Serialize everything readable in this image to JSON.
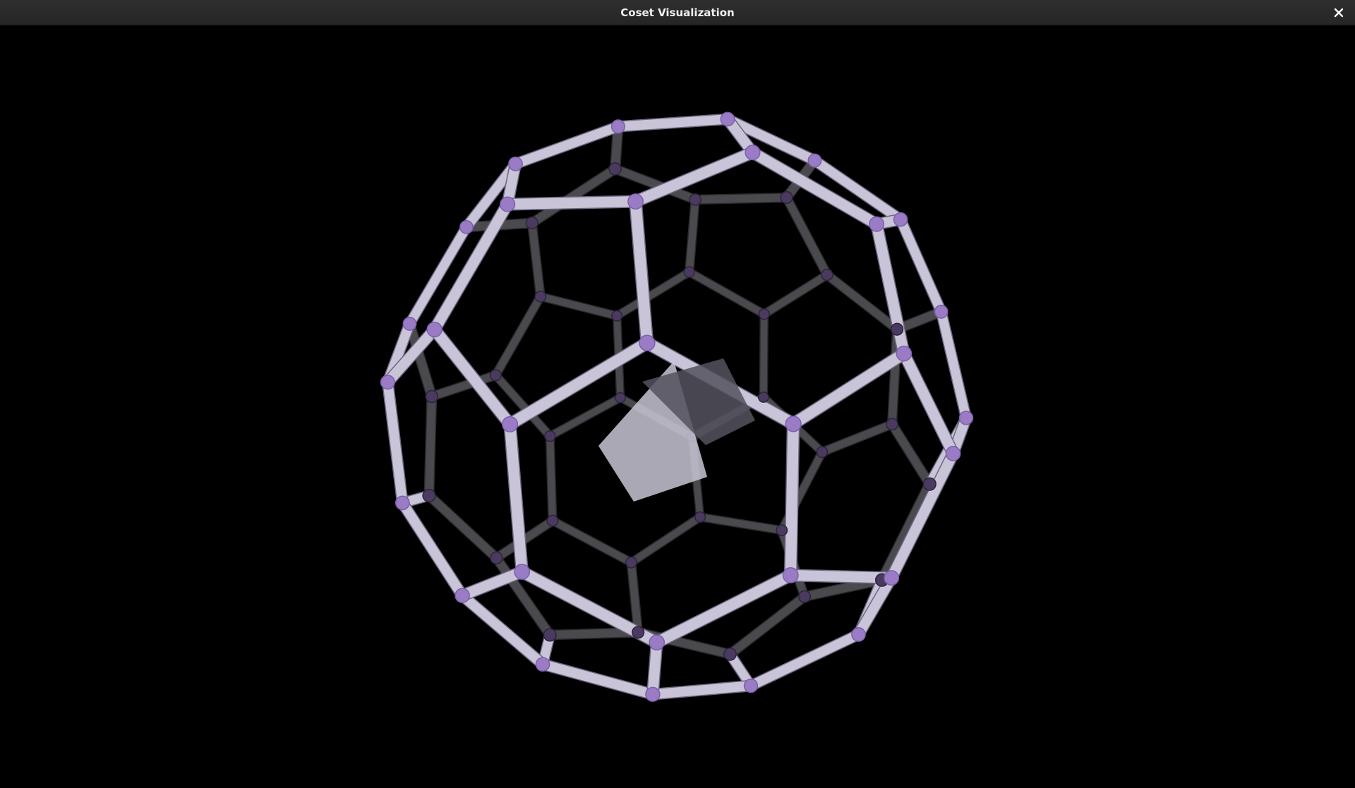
{
  "window": {
    "title": "Coset Visualization"
  },
  "titlebar": {
    "close_icon": "close-icon"
  },
  "scene": {
    "object": "truncated icosahedron wireframe",
    "colors": {
      "background": "#000000",
      "edge_front": "#c9c4d8",
      "edge_back": "#4a4a4e",
      "vertex_front": "#9a7cc6",
      "vertex_back": "#4a3a60",
      "face_highlight": "#c8c6d4"
    }
  }
}
